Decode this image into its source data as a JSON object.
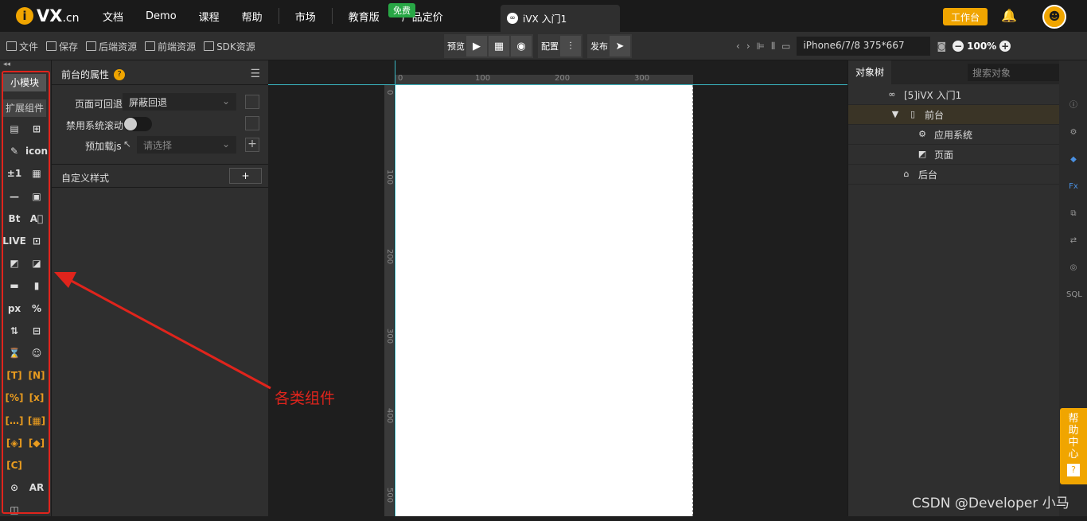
{
  "brand": {
    "logo_letter": "i",
    "logo_text": "VX",
    "logo_suffix": ".cn"
  },
  "nav": {
    "items": [
      "文档",
      "Demo",
      "课程",
      "帮助"
    ],
    "market": "市场",
    "edu": "教育版",
    "free_badge": "免费",
    "pricing": "产品定价"
  },
  "doc_tab": {
    "title": "iVX 入门1"
  },
  "header_right": {
    "workbench": "工作台"
  },
  "toolbar": {
    "file": "文件",
    "save": "保存",
    "backend": "后端资源",
    "frontend": "前端资源",
    "sdk": "SDK资源",
    "preview": "预览",
    "config": "配置",
    "publish": "发布",
    "device": "iPhone6/7/8 375*667",
    "zoom": "100%"
  },
  "components": {
    "tab_small": "小模块",
    "tab_ext": "扩展组件",
    "cells": [
      "▤",
      "⊞",
      "✎",
      "icon",
      "±1",
      "▦",
      "—",
      "▣",
      "Bt",
      "A⃝",
      "LIVE",
      "⊡",
      "◩",
      "◪",
      "▬",
      "▮",
      "px",
      "%",
      "⇅",
      "⊟",
      "⌛",
      "☺",
      "[T]",
      "[N]",
      "[%]",
      "[x]",
      "[…]",
      "[▦]",
      "[◈]",
      "[◆]",
      "[C]",
      "",
      "⊙",
      "AR",
      "◫",
      ""
    ]
  },
  "props": {
    "title": "前台的属性",
    "back_label": "页面可回退",
    "back_value": "屏蔽回退",
    "scroll_label": "禁用系统滚动",
    "preload_label": "预加载js",
    "preload_placeholder": "请选择",
    "custom_style": "自定义样式",
    "add": "+"
  },
  "ruler": {
    "top": [
      "0",
      "100",
      "200",
      "300"
    ],
    "left": [
      "0",
      "100",
      "200",
      "300",
      "400",
      "500"
    ]
  },
  "annotation": "各类组件",
  "tree": {
    "tab": "对象树",
    "search_placeholder": "搜索对象",
    "nodes": [
      "[5]iVX 入门1",
      "前台",
      "应用系统",
      "页面",
      "后台"
    ]
  },
  "help": {
    "text": "帮助中心",
    "q": "?"
  },
  "watermark": "CSDN @Developer 小马",
  "colors": {
    "accent": "#f0a500",
    "annotation": "#e0241c",
    "guide": "#3ab8c4"
  }
}
